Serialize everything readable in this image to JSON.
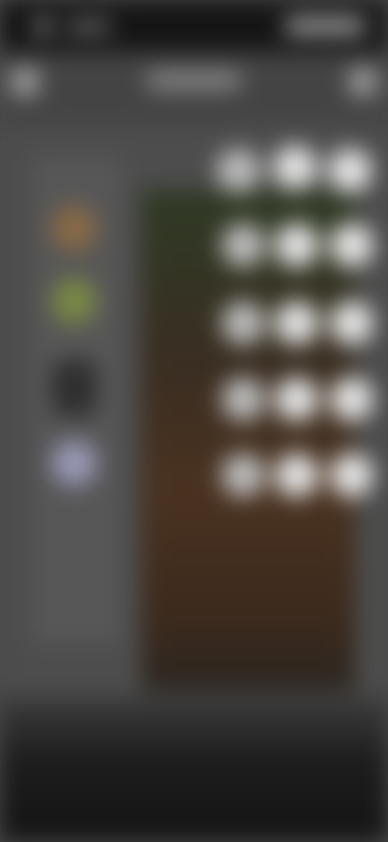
{
  "app": {
    "title": ""
  },
  "status_bar": {
    "time": "",
    "indicators": ""
  },
  "header": {
    "title": "",
    "left_button_icon": "back-icon",
    "right_button_icon": "more-icon"
  },
  "sidebar": {
    "swatches": [
      {
        "name": "swatch-orange",
        "color": "#8a6a45"
      },
      {
        "name": "swatch-green",
        "color": "#7a8a45"
      },
      {
        "name": "swatch-dark",
        "color": "#2f2f2f"
      },
      {
        "name": "swatch-lavender",
        "color": "#9a9ab8"
      }
    ]
  },
  "grid": {
    "rows": 5,
    "columns": 3
  },
  "colors": {
    "background": "#4a4a4a",
    "status_bar": "#151515",
    "bottom": "#141414"
  }
}
